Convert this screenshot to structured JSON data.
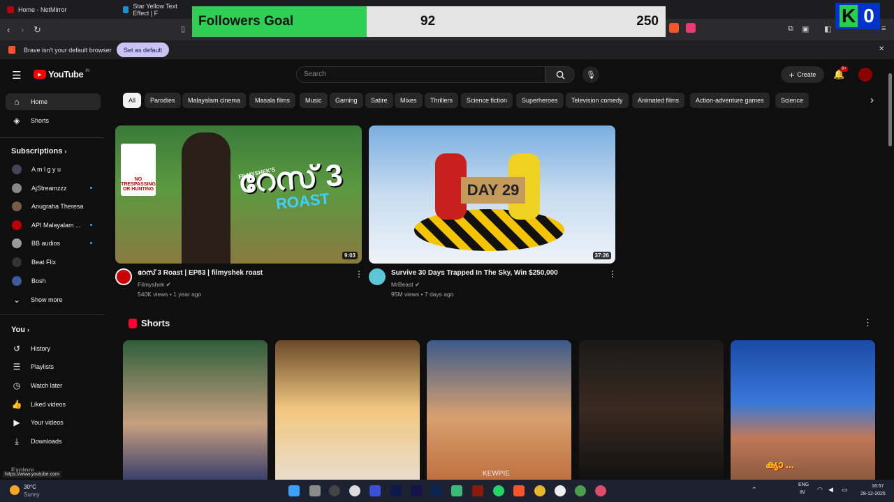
{
  "tabs": [
    {
      "title": "Home - NetMirror"
    },
    {
      "title": "Star Yellow Text Effect | F"
    }
  ],
  "goal": {
    "label": "Followers Goal",
    "current": "92",
    "target": "250",
    "progress": 0.368
  },
  "k0": {
    "k": "K",
    "o": "0"
  },
  "notice": {
    "text": "Brave isn't your default browser",
    "button": "Set as default",
    "close": "✕"
  },
  "header": {
    "logo": "YouTube",
    "logo_sup": "IN",
    "search_placeholder": "Search",
    "create": "Create",
    "notif_badge": "9+"
  },
  "sidebar": {
    "main": [
      {
        "label": "Home"
      },
      {
        "label": "Shorts"
      }
    ],
    "subscriptions_title": "Subscriptions",
    "subs": [
      {
        "label": "A m l g y u",
        "dot": false
      },
      {
        "label": "AjStreamzzz",
        "dot": true
      },
      {
        "label": "Anugraha Theresa",
        "dot": false
      },
      {
        "label": "API Malayalam ...",
        "dot": true
      },
      {
        "label": "BB audios",
        "dot": true
      },
      {
        "label": "Beat Flix",
        "dot": false
      },
      {
        "label": "Bosh",
        "dot": false
      }
    ],
    "show_more": "Show more",
    "you_title": "You",
    "you": [
      {
        "label": "History"
      },
      {
        "label": "Playlists"
      },
      {
        "label": "Watch later"
      },
      {
        "label": "Liked videos"
      },
      {
        "label": "Your videos"
      },
      {
        "label": "Downloads"
      }
    ],
    "explore": "Explore"
  },
  "chips": [
    "All",
    "Parodies",
    "Malayalam cinema",
    "Masala films",
    "Music",
    "Gaming",
    "Satire",
    "Mixes",
    "Thrillers",
    "Science fiction",
    "Superheroes",
    "Television comedy",
    "Animated films",
    "Action-adventure games",
    "Science"
  ],
  "videos": [
    {
      "title": "റേസ് 3 Roast | EP83 | filmyshek roast",
      "channel": "Filmyshek",
      "meta": "540K views • 1 year ago",
      "duration": "9:03",
      "thumb_text": "റേസ് 3",
      "thumb_sub": "ROAST",
      "thumb_brand": "FILMYSHEK'S",
      "sign": "NO TRESPASSING OR HUNTING"
    },
    {
      "title": "Survive 30 Days Trapped In The Sky, Win $250,000",
      "channel": "MrBeast",
      "meta": "95M views • 7 days ago",
      "duration": "37:26",
      "thumb_text": "DAY 29"
    }
  ],
  "shorts_title": "Shorts",
  "shorts_text": {
    "s3": "KEWPIE",
    "s5": "ക്യാ ..."
  },
  "status_url": "https://www.youtube.com",
  "taskbar": {
    "weather_temp": "30°C",
    "weather_desc": "Sunny",
    "lang1": "ENG",
    "lang2": "IN",
    "time": "16:57",
    "date": "28-12-2025"
  }
}
